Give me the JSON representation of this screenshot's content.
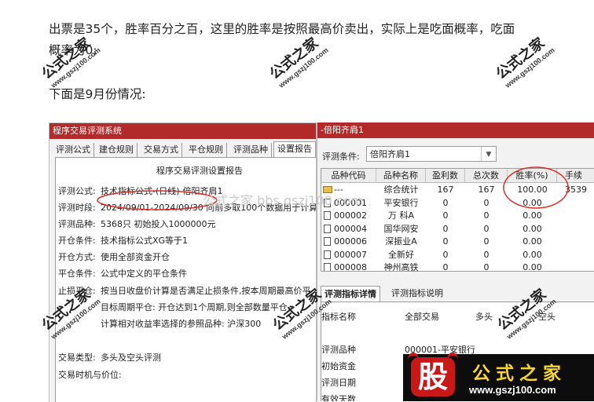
{
  "article": {
    "line1": "出票是35个，胜率百分之百，这里的胜率是按照最高价卖出，实际上是吃面概率，吃面",
    "line2": "概率为0;",
    "line3": "下面是9月份情况:"
  },
  "left_window": {
    "title": "程序交易评测系统",
    "tabs": [
      "评测公式",
      "建仓规则",
      "交易方式",
      "平仓规则",
      "评测品种",
      "设置报告"
    ],
    "report_title": "程序交易评测设置报告",
    "rows": [
      {
        "label": "评测公式:",
        "value": "技术指标公式-(日线)-倍阳齐肩1"
      },
      {
        "label": "评测时段:",
        "value": "2024/09/01-2024/09/30 向前多取100个数据用于计算"
      },
      {
        "label": "评测品种:",
        "value": "5368只 初始投入1000000元"
      },
      {
        "label": "开仓条件:",
        "value": "技术指标公式XG等于1"
      },
      {
        "label": "开仓方式:",
        "value": "使用全部资金开仓"
      },
      {
        "label": "平仓条件:",
        "value": "公式中定义的平仓条件"
      },
      {
        "label": "止损平仓:",
        "value": "按当日收盘价计算是否满足止损条件,按本周期最高价平"
      },
      {
        "label": "",
        "value": "目标周期平仓:  开仓达到1个周期,则全部数量平仓"
      },
      {
        "label": "",
        "value": "计算相对收益率选择的参照品种:  沪深300"
      },
      {
        "label": "交易类型:",
        "value": "多头及空头评测"
      },
      {
        "label": "交易时机与价位:",
        "value": ""
      }
    ]
  },
  "right_window": {
    "title": "-倍阳齐肩1",
    "condition_label": "评测条件:",
    "condition_value": "倍阳齐肩1",
    "columns": [
      "品种代码",
      "品种名称",
      "盈利数",
      "总次数",
      "胜率(%)",
      "手续"
    ],
    "rows": [
      {
        "icon": "folder-icon",
        "code": "---",
        "name": "综合统计",
        "profit": "167",
        "total": "167",
        "winrate": "100.00",
        "fee": "3539"
      },
      {
        "icon": "document-icon",
        "code": "000001",
        "name": "平安银行",
        "profit": "0",
        "total": "0",
        "winrate": "0.00",
        "fee": ""
      },
      {
        "icon": "document-icon",
        "code": "000002",
        "name": "万 科A",
        "profit": "0",
        "total": "0",
        "winrate": "0.00",
        "fee": ""
      },
      {
        "icon": "document-icon",
        "code": "000004",
        "name": "国华网安",
        "profit": "0",
        "total": "0",
        "winrate": "0.00",
        "fee": ""
      },
      {
        "icon": "document-icon",
        "code": "000006",
        "name": "深振业A",
        "profit": "0",
        "total": "0",
        "winrate": "0.00",
        "fee": ""
      },
      {
        "icon": "document-icon",
        "code": "000007",
        "name": "全新好",
        "profit": "0",
        "total": "0",
        "winrate": "0.00",
        "fee": ""
      },
      {
        "icon": "document-icon",
        "code": "000008",
        "name": "神州高铁",
        "profit": "0",
        "total": "0",
        "winrate": "0.00",
        "fee": ""
      }
    ],
    "tabs": [
      "评测指标详情",
      "评测指标说明"
    ],
    "detail_header": [
      "指标名称",
      "全部交易",
      "多头",
      "空头"
    ],
    "detail_rows": [
      {
        "label": "评测品种",
        "value": "000001-平安银行"
      },
      {
        "label": "初始资金",
        "value": ""
      },
      {
        "label": "评测日期",
        "value": ""
      },
      {
        "label": "有效天数",
        "value": ""
      }
    ]
  },
  "watermark": {
    "text": "公式之家",
    "url": "www.gszj100.com",
    "ghost": "公式之家 bbs.gszj100.com"
  },
  "logo": {
    "badge": "股",
    "name": "公式之家",
    "url": "www.gszj100.com"
  },
  "annotation_color": "#d9302a"
}
